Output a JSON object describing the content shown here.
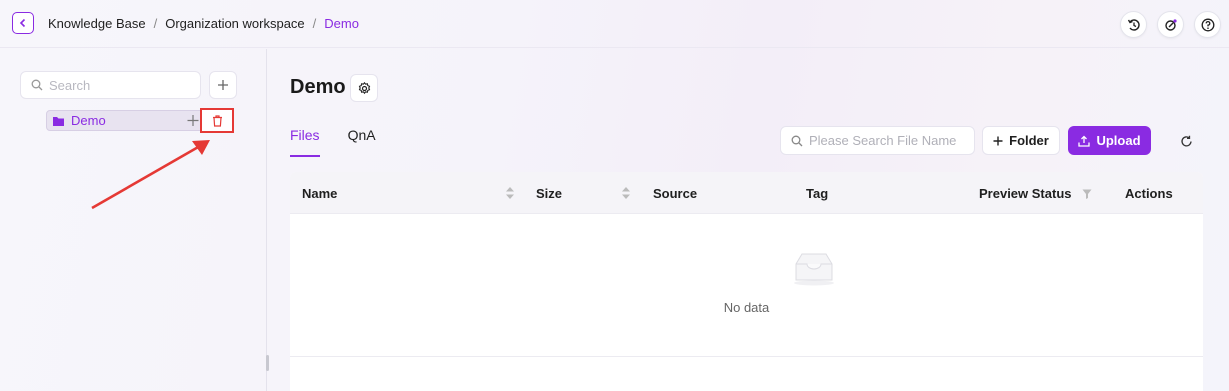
{
  "topbar": {
    "breadcrumb": [
      "Knowledge Base",
      "Organization workspace",
      "Demo"
    ],
    "separator": "/",
    "icons": [
      "history-icon",
      "sparkle-edit-icon",
      "help-icon"
    ]
  },
  "sidebar": {
    "search_placeholder": "Search",
    "tree": [
      {
        "label": "Demo",
        "icon": "folder-icon"
      }
    ]
  },
  "main": {
    "title": "Demo",
    "tabs": [
      {
        "label": "Files",
        "active": true
      },
      {
        "label": "QnA",
        "active": false
      }
    ],
    "file_search_placeholder": "Please Search File Name",
    "folder_label": "Folder",
    "upload_label": "Upload",
    "columns": [
      "Name",
      "Size",
      "Source",
      "Tag",
      "Preview Status",
      "Actions"
    ],
    "empty_text": "No data"
  },
  "colors": {
    "accent": "#8a2be2",
    "highlight": "#e53935"
  }
}
